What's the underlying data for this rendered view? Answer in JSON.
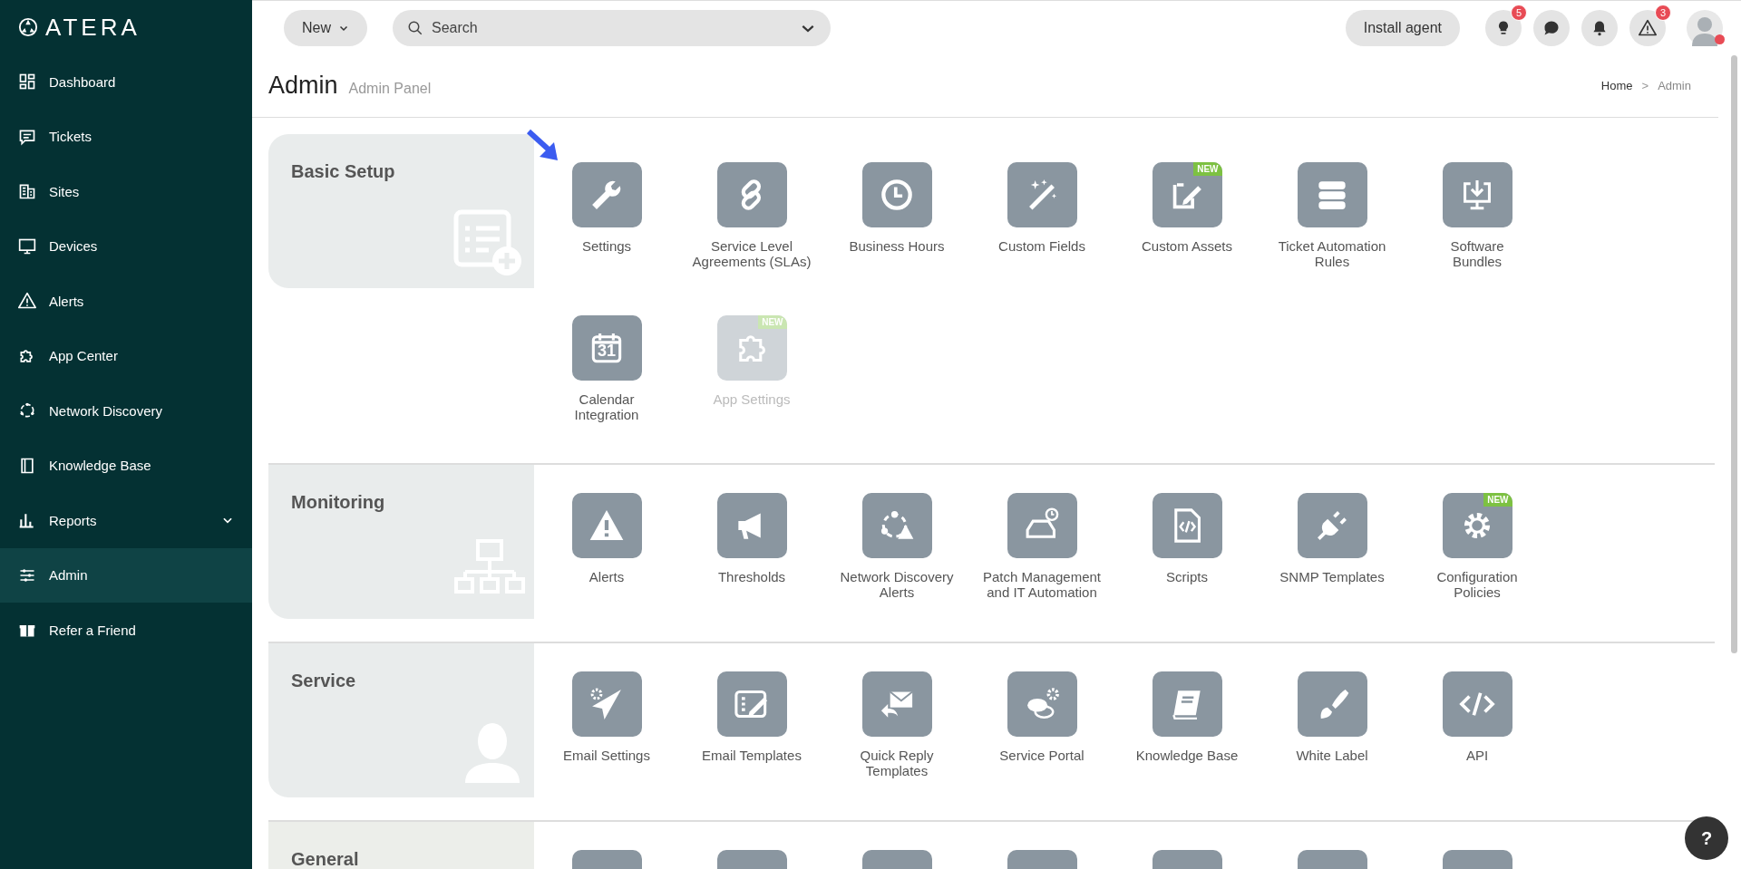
{
  "sidebar": {
    "logo": "ATERA",
    "items": [
      {
        "label": "Dashboard",
        "selected": false
      },
      {
        "label": "Tickets",
        "selected": false
      },
      {
        "label": "Sites",
        "selected": false
      },
      {
        "label": "Devices",
        "selected": false
      },
      {
        "label": "Alerts",
        "selected": false
      },
      {
        "label": "App Center",
        "selected": false
      },
      {
        "label": "Network Discovery",
        "selected": false
      },
      {
        "label": "Knowledge Base",
        "selected": false
      },
      {
        "label": "Reports",
        "selected": false,
        "expandable": true
      },
      {
        "label": "Admin",
        "selected": true
      },
      {
        "label": "Refer a Friend",
        "selected": false
      }
    ]
  },
  "topbar": {
    "new_button": "New",
    "search": {
      "placeholder": "Search"
    },
    "install_button": "Install agent",
    "icons": [
      {
        "kind": "bulb",
        "count": "5"
      },
      {
        "kind": "chat"
      },
      {
        "kind": "bell"
      },
      {
        "kind": "warning",
        "count": "3"
      }
    ],
    "avatar": {
      "status_dot": true
    }
  },
  "page": {
    "title": "Admin",
    "subtitle": "Admin Panel",
    "breadcrumb": [
      {
        "label": "Home",
        "current": false
      },
      {
        "label": "Admin",
        "current": true
      }
    ],
    "breadcrumb_separator": ">"
  },
  "sections": [
    {
      "title": "Basic Setup",
      "items": [
        {
          "kind": "entry",
          "label": "Settings",
          "pointer": true
        },
        {
          "kind": "entry",
          "label": "Service Level\nAgreements (SLAs)"
        },
        {
          "kind": "entry",
          "label": "Business Hours"
        },
        {
          "kind": "entry",
          "label": "Custom Fields"
        },
        {
          "kind": "entry",
          "label": "Custom Assets",
          "badge": "NEW"
        },
        {
          "kind": "entry",
          "label": "Ticket Automation\nRules"
        },
        {
          "kind": "entry",
          "label": "Software\nBundles"
        },
        {
          "kind": "entry",
          "label": "Calendar\nIntegration",
          "glyph": "31"
        },
        {
          "kind": "entry",
          "label": "App Settings",
          "badge": "NEW",
          "disabled": true
        }
      ]
    },
    {
      "title": "Monitoring",
      "items": [
        {
          "kind": "entry",
          "label": "Alerts"
        },
        {
          "kind": "entry",
          "label": "Thresholds"
        },
        {
          "kind": "entry",
          "label": "Network Discovery\nAlerts"
        },
        {
          "kind": "entry",
          "label": "Patch Management\nand IT Automation"
        },
        {
          "kind": "entry",
          "label": "Scripts"
        },
        {
          "kind": "entry",
          "label": "SNMP Templates"
        },
        {
          "kind": "entry",
          "label": "Configuration\nPolicies",
          "badge": "NEW"
        }
      ]
    },
    {
      "title": "Service",
      "items": [
        {
          "kind": "entry",
          "label": "Email Settings"
        },
        {
          "kind": "entry",
          "label": "Email Templates"
        },
        {
          "kind": "entry",
          "label": "Quick Reply\nTemplates"
        },
        {
          "kind": "entry",
          "label": "Service Portal"
        },
        {
          "kind": "entry",
          "label": "Knowledge Base"
        },
        {
          "kind": "entry",
          "label": "White Label"
        },
        {
          "kind": "entry",
          "label": "API"
        }
      ]
    },
    {
      "title": "General",
      "items": [
        {
          "kind": "cut-off"
        },
        {
          "kind": "cut-off"
        },
        {
          "kind": "cut-off"
        },
        {
          "kind": "cut-off"
        },
        {
          "kind": "cut-off"
        },
        {
          "kind": "cut-off"
        },
        {
          "kind": "cut-off"
        }
      ]
    }
  ],
  "help_button": "?"
}
